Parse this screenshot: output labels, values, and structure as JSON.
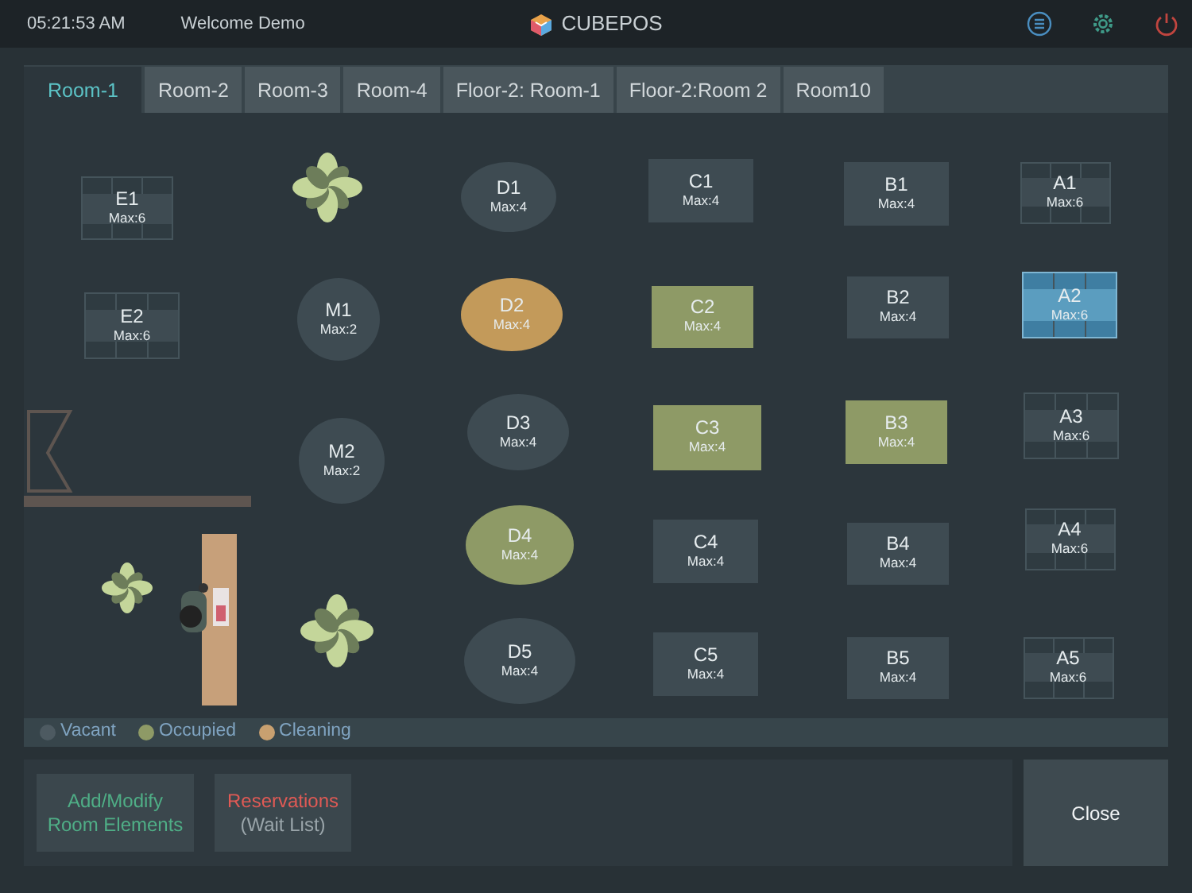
{
  "header": {
    "time": "05:21:53 AM",
    "welcome": "Welcome Demo",
    "app_name": "CUBEPOS"
  },
  "tabs": [
    {
      "label": "Room-1",
      "selected": true
    },
    {
      "label": "Room-2",
      "selected": false
    },
    {
      "label": "Room-3",
      "selected": false
    },
    {
      "label": "Room-4",
      "selected": false
    },
    {
      "label": "Floor-2: Room-1",
      "selected": false
    },
    {
      "label": "Floor-2:Room 2",
      "selected": false
    },
    {
      "label": "Room10",
      "selected": false
    }
  ],
  "tables": [
    {
      "name": "E1",
      "max": "Max:6",
      "kind": "grid",
      "color": "#3e4b52",
      "selected": false
    },
    {
      "name": "E2",
      "max": "Max:6",
      "kind": "grid",
      "color": "#3e4b52",
      "selected": false
    },
    {
      "name": "M1",
      "max": "Max:2",
      "kind": "round",
      "color": "#3e4b52",
      "selected": false
    },
    {
      "name": "M2",
      "max": "Max:2",
      "kind": "round",
      "color": "#3e4b52",
      "selected": false
    },
    {
      "name": "D1",
      "max": "Max:4",
      "kind": "round",
      "color": "#3e4b52",
      "selected": false
    },
    {
      "name": "D2",
      "max": "Max:4",
      "kind": "round",
      "color": "#c39a5a",
      "selected": false
    },
    {
      "name": "D3",
      "max": "Max:4",
      "kind": "round",
      "color": "#3e4b52",
      "selected": false
    },
    {
      "name": "D4",
      "max": "Max:4",
      "kind": "round",
      "color": "#8e9a66",
      "selected": false
    },
    {
      "name": "D5",
      "max": "Max:4",
      "kind": "round",
      "color": "#3e4b52",
      "selected": false
    },
    {
      "name": "C1",
      "max": "Max:4",
      "kind": "rect",
      "color": "#3e4b52",
      "selected": false
    },
    {
      "name": "C2",
      "max": "Max:4",
      "kind": "rect",
      "color": "#8e9a66",
      "selected": false
    },
    {
      "name": "C3",
      "max": "Max:4",
      "kind": "rect",
      "color": "#8e9a66",
      "selected": false
    },
    {
      "name": "C4",
      "max": "Max:4",
      "kind": "rect",
      "color": "#3e4b52",
      "selected": false
    },
    {
      "name": "C5",
      "max": "Max:4",
      "kind": "rect",
      "color": "#3e4b52",
      "selected": false
    },
    {
      "name": "B1",
      "max": "Max:4",
      "kind": "rect",
      "color": "#3e4b52",
      "selected": false
    },
    {
      "name": "B2",
      "max": "Max:4",
      "kind": "rect",
      "color": "#3e4b52",
      "selected": false
    },
    {
      "name": "B3",
      "max": "Max:4",
      "kind": "rect",
      "color": "#8e9a66",
      "selected": false
    },
    {
      "name": "B4",
      "max": "Max:4",
      "kind": "rect",
      "color": "#3e4b52",
      "selected": false
    },
    {
      "name": "B5",
      "max": "Max:4",
      "kind": "rect",
      "color": "#3e4b52",
      "selected": false
    },
    {
      "name": "A1",
      "max": "Max:6",
      "kind": "grid",
      "color": "#3e4b52",
      "selected": false
    },
    {
      "name": "A2",
      "max": "Max:6",
      "kind": "grid",
      "selected": true
    },
    {
      "name": "A3",
      "max": "Max:6",
      "kind": "grid",
      "color": "#3e4b52",
      "selected": false
    },
    {
      "name": "A4",
      "max": "Max:6",
      "kind": "grid",
      "color": "#3e4b52",
      "selected": false
    },
    {
      "name": "A5",
      "max": "Max:6",
      "kind": "grid",
      "color": "#3e4b52",
      "selected": false
    }
  ],
  "legend": [
    {
      "label": "Vacant",
      "color": "#4d5a61"
    },
    {
      "label": "Occupied",
      "color": "#8e9a66"
    },
    {
      "label": "Cleaning",
      "color": "#c8a070"
    }
  ],
  "actions": [
    {
      "label": "Add/Modify Room Elements",
      "kind": "edit"
    },
    {
      "label": "Reservations",
      "sublabel": "(Wait List)",
      "kind": "reserve"
    }
  ],
  "close_button": "Close"
}
